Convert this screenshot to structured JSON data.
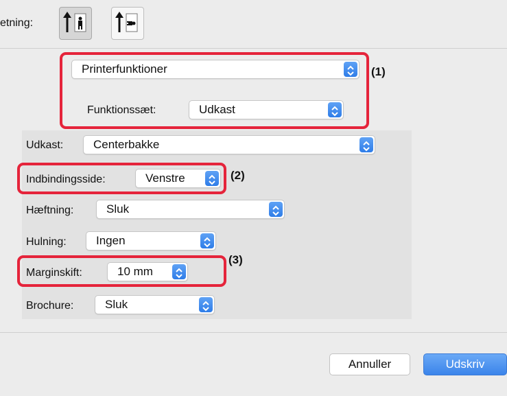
{
  "orientation": {
    "label_partial": "etning:",
    "portrait_icon": "portrait-orientation-icon",
    "landscape_icon": "landscape-orientation-icon"
  },
  "printer_menu": {
    "value": "Printerfunktioner"
  },
  "feature_set": {
    "label": "Funktionssæt:",
    "value": "Udkast"
  },
  "options": {
    "udkast": {
      "label": "Udkast:",
      "value": "Centerbakke"
    },
    "binding": {
      "label": "Indbindingsside:",
      "value": "Venstre"
    },
    "stapling": {
      "label": "Hæftning:",
      "value": "Sluk"
    },
    "punching": {
      "label": "Hulning:",
      "value": "Ingen"
    },
    "margin": {
      "label": "Marginskift:",
      "value": "10 mm"
    },
    "brochure": {
      "label": "Brochure:",
      "value": "Sluk"
    }
  },
  "annotations": {
    "a1": "(1)",
    "a2": "(2)",
    "a3": "(3)"
  },
  "buttons": {
    "cancel": "Annuller",
    "print": "Udskriv"
  },
  "colors": {
    "highlight": "#e5243b",
    "accent": "#2f7de8",
    "panel": "#ececec",
    "group": "#e2e2e2"
  }
}
